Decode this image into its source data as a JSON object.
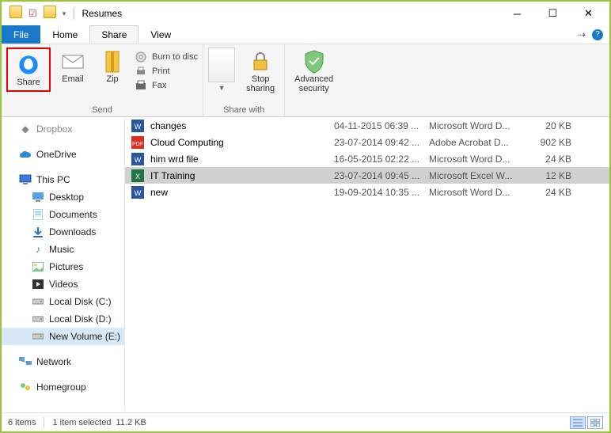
{
  "title": "Resumes",
  "tabs": {
    "file": "File",
    "home": "Home",
    "share": "Share",
    "view": "View"
  },
  "ribbon": {
    "share_btn": "Share",
    "email": "Email",
    "zip": "Zip",
    "burn": "Burn to disc",
    "print": "Print",
    "fax": "Fax",
    "send_group": "Send",
    "stop_sharing": "Stop\nsharing",
    "share_with_group": "Share with",
    "adv_security": "Advanced\nsecurity"
  },
  "nav": {
    "cut_prev": "Dropbox",
    "onedrive": "OneDrive",
    "thispc": "This PC",
    "desktop": "Desktop",
    "documents": "Documents",
    "downloads": "Downloads",
    "music": "Music",
    "pictures": "Pictures",
    "videos": "Videos",
    "localc": "Local Disk (C:)",
    "locale_d": "Local Disk (D:)",
    "newvol": "New Volume (E:)",
    "network": "Network",
    "homegroup": "Homegroup"
  },
  "files": [
    {
      "name": "changes",
      "date": "04-11-2015 06:39 ...",
      "type": "Microsoft Word D...",
      "size": "20 KB",
      "kind": "word"
    },
    {
      "name": "Cloud Computing",
      "date": "23-07-2014 09:42 ...",
      "type": "Adobe Acrobat D...",
      "size": "902 KB",
      "kind": "pdf"
    },
    {
      "name": "him wrd file",
      "date": "16-05-2015 02:22 ...",
      "type": "Microsoft Word D...",
      "size": "24 KB",
      "kind": "word"
    },
    {
      "name": "IT Training",
      "date": "23-07-2014 09:45 ...",
      "type": "Microsoft Excel W...",
      "size": "12 KB",
      "kind": "excel",
      "selected": true
    },
    {
      "name": "new",
      "date": "19-09-2014 10:35 ...",
      "type": "Microsoft Word D...",
      "size": "24 KB",
      "kind": "word"
    }
  ],
  "status": {
    "items": "6 items",
    "selected": "1 item selected",
    "size": "11.2 KB"
  }
}
